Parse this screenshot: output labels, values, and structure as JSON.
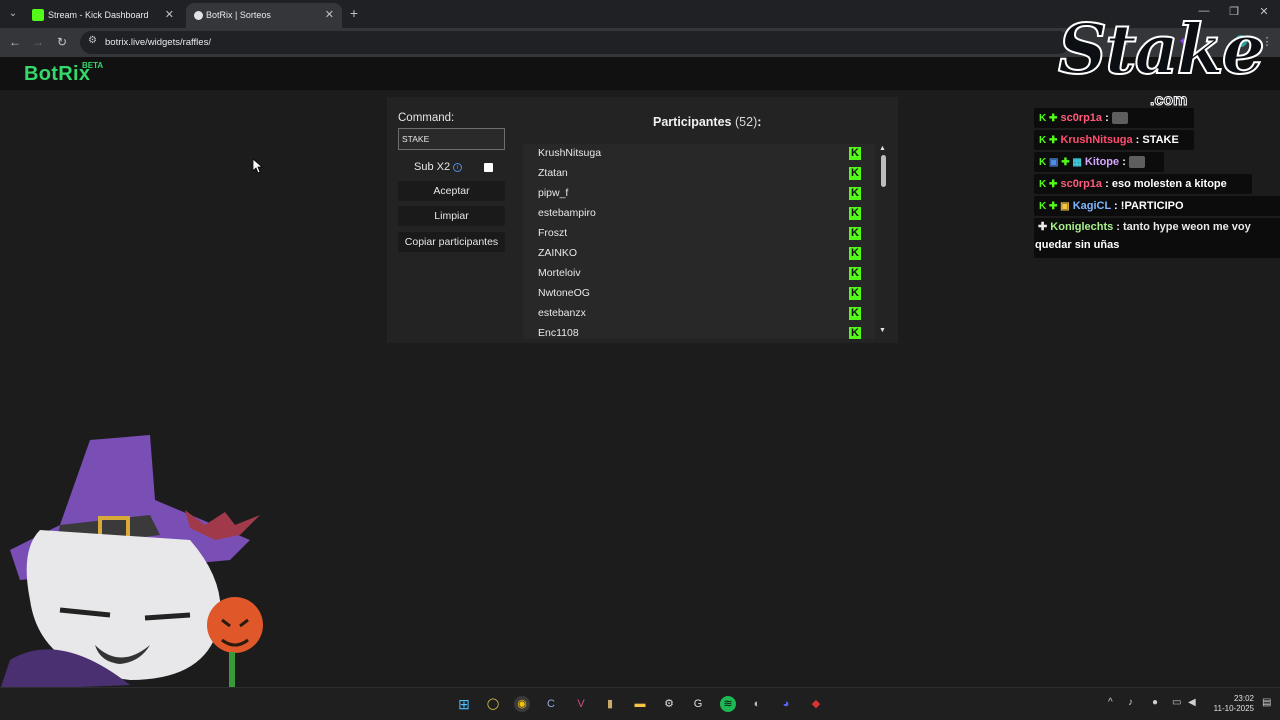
{
  "browser": {
    "tabs": [
      {
        "title": "Stream - Kick Dashboard",
        "active": false
      },
      {
        "title": "BotRix | Sorteos",
        "active": true
      }
    ],
    "url": "botrix.live/widgets/raffles/"
  },
  "botrix": {
    "logo": "BotRix",
    "badge": "BETA"
  },
  "raffle": {
    "command_label": "Command:",
    "command_value": "STAKE",
    "sub_label": "Sub X2",
    "sub_checked": false,
    "accept_label": "Aceptar",
    "clear_label": "Limpiar",
    "copy_label": "Copiar participantes",
    "participants_label": "Participantes",
    "participants_count": "(52)",
    "participants_colon": ":",
    "participants": [
      "KrushNitsuga",
      "Ztatan",
      "pipw_f",
      "estebampiro",
      "Froszt",
      "ZAINKO",
      "Morteloiv",
      "NwtoneOG",
      "estebanzx",
      "Enc1108"
    ]
  },
  "overlay": {
    "brand": "Stake",
    "brand_domain": ".com",
    "chat": [
      {
        "user": "sc0rp1a",
        "sep": " :",
        "msg": "",
        "user_color": "#ff5c7a",
        "emote": true
      },
      {
        "user": "KrushNitsuga",
        "sep": " :",
        "msg": " STAKE",
        "user_color": "#ff4d6d",
        "emote": false
      },
      {
        "user": "Kitope",
        "sep": " :",
        "msg": "",
        "user_color": "#d7a6ff",
        "emote": true
      },
      {
        "user": "sc0rp1a",
        "sep": " :",
        "msg": " eso molesten a kitope",
        "user_color": "#ff5c7a",
        "emote": false
      },
      {
        "user": "KagiCL",
        "sep": " :",
        "msg": " !PARTICIPO",
        "user_color": "#7fb6ff",
        "emote": false
      }
    ],
    "long_chat": {
      "user": "Koniglechts",
      "user_color": "#a6f08a",
      "msg_line1": " : tanto hype weon me voy",
      "msg_line2": "quedar sin uñas"
    }
  },
  "taskbar": {
    "time": "23:02",
    "date": "11-10-2025"
  }
}
